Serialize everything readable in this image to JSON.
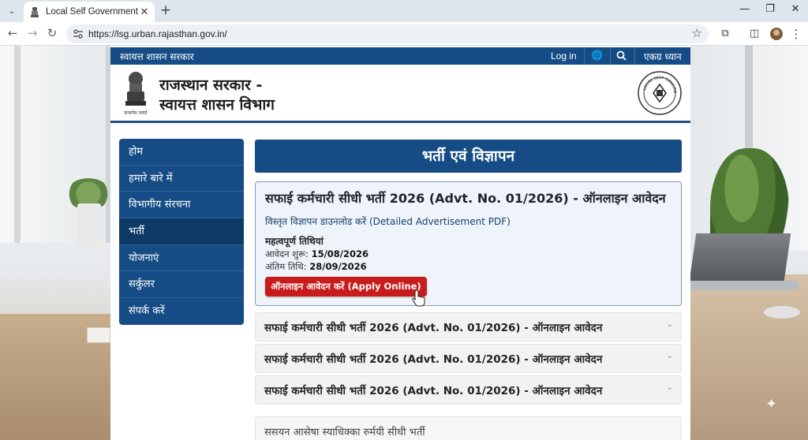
{
  "browser": {
    "tab_title": "Local Self Government Depart",
    "url": "https://lsg.urban.rajasthan.gov.in/",
    "icons": [
      "tab-search-icon",
      "close-icon",
      "new-tab-icon",
      "minimize-icon",
      "maximize-icon",
      "close-window-icon",
      "back-icon",
      "forward-icon",
      "reload-icon",
      "site-info-icon",
      "bookmark-star-icon",
      "extensions-icon",
      "sidebar-icon",
      "profile-avatar",
      "menu-icon"
    ]
  },
  "site": {
    "topbar": {
      "left_text": "स्वायत्त शासन सरकार",
      "login": "Log in",
      "skip": "एकग्र ध्यान",
      "icons": [
        "globe-icon",
        "search-icon"
      ]
    },
    "header": {
      "title_line1": "राजस्थान सरकार -",
      "title_line2": "स्वायत्त शासन विभाग",
      "emblem_caption": "सत्यमेव जयते",
      "dept_logo_text": "LOCAL SELF GOVERNMENT"
    },
    "sidebar": {
      "items": [
        "होम",
        "हमारे बारे में",
        "विभागीय संरचना",
        "भर्ती",
        "योजनाएं",
        "सर्कुलर",
        "संपर्क करें"
      ],
      "active": "भर्ती"
    },
    "banner": "भर्ती एवं विज्ञापन",
    "card": {
      "title": "सफाई कर्मचारी सीधी भर्ती 2026 (Advt. No. 01/2026) - ऑनलाइन आवेदन",
      "pdf_link": "विस्तृत विज्ञापन डाउनलोड करें (Detailed Advertisement PDF)",
      "dates_heading": "महत्वपूर्ण तिथियां",
      "start_label": "आवेदन शुरू: ",
      "start_date": "15/08/2026",
      "end_label": "अंतिम तिथि: ",
      "end_date": "28/09/2026",
      "apply_button": "ऑनलाइन आवेदन करें (Apply Online)"
    },
    "accordions": [
      "सफाई कर्मचारी सीधी भर्ती 2026 (Advt. No. 01/2026) - ऑनलाइन आवेदन",
      "सफाई कर्मचारी सीधी भर्ती 2026 (Advt. No. 01/2026) - ऑनलाइन आवेदन",
      "सफाई कर्मचारी सीधी भर्ती 2026 (Advt. No. 01/2026) - ऑनलाइन आवेदन"
    ],
    "bottom_item": "ससयन आसेषा स्याधिक्का रुर्मयी सीधी भर्ती",
    "colors": {
      "primary_blue": "#154c85",
      "apply_red": "#c81b1b",
      "card_bg": "#eef4fa"
    }
  }
}
